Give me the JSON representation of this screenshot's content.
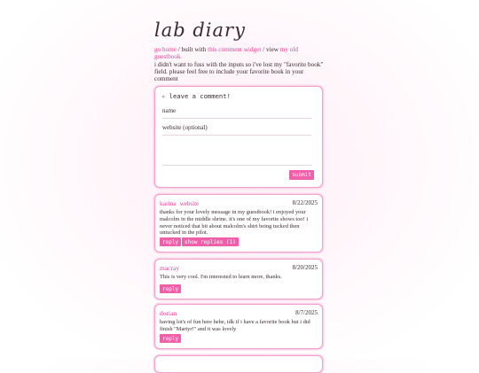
{
  "page": {
    "title": "lab diary"
  },
  "intro": {
    "link_home": "go home",
    "sep1": " / built with ",
    "link_widget": "this comment widget",
    "sep2": " / view ",
    "link_guestbook": "my old guestbook",
    "note": "i didn't want to fuss with the inputs so i've lost my \"favorite book\" field. please feel free to include your favorite book in your comment"
  },
  "form": {
    "heading": "✧ leave a comment!",
    "name_placeholder": "name",
    "website_placeholder": "website (optional)",
    "submit_label": "submit"
  },
  "comments": [
    {
      "name": "karina",
      "website_label": "website",
      "date": "8/22/2025",
      "text": "thanks for your lovely message in my guestbook! i enjoyed your malcolm in the middle shrine. it's one of my favorite shows too! i never noticed that bit about malcolm's shirt being tucked then untucked in the pilot.",
      "reply_label": "reply",
      "show_replies_label": "show replies (1)"
    },
    {
      "name": "macray",
      "date": "8/20/2025",
      "text": "This is very cool. I'm interested to learn more, thanks.",
      "reply_label": "reply"
    },
    {
      "name": "dorian",
      "date": "8/7/2025",
      "text": "having lot's of fun here hehe, idk if i have a favorite book but i did finish \"Martyr!\" and it was lovely",
      "reply_label": "reply"
    }
  ],
  "colors": {
    "accent": "#f060aa",
    "link": "#e0449c",
    "border": "#f0a0cc"
  }
}
